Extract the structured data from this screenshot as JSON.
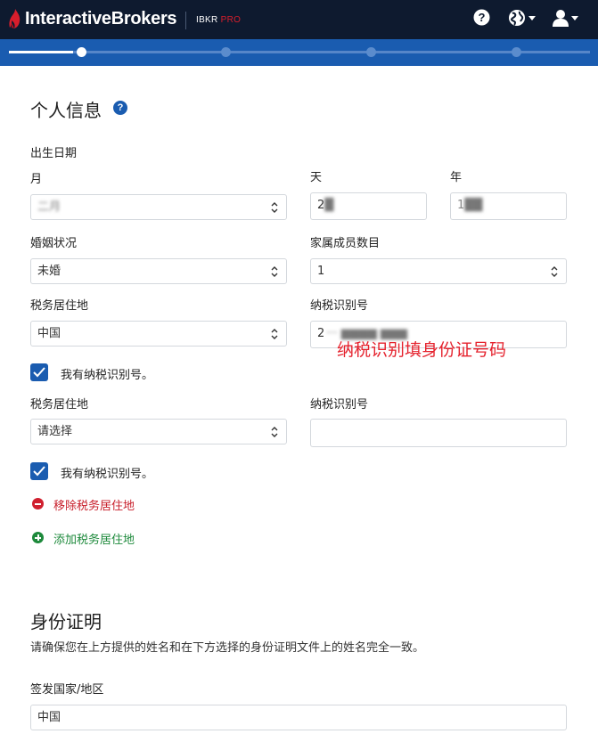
{
  "header": {
    "brand": "InteractiveBrokers",
    "product_prefix": "IBKR ",
    "product_suffix": "PRO",
    "brand_color": "#0e1a2f",
    "accent_color": "#d81e2c",
    "icons": [
      "help-icon",
      "globe-icon",
      "user-icon"
    ]
  },
  "progress": {
    "total_steps": 4,
    "current_step": 1,
    "bar_color": "#1a5cb0"
  },
  "personal_info": {
    "title": "个人信息",
    "dob_label": "出生日期",
    "month_label": "月",
    "month_value": "二月",
    "day_label": "天",
    "day_value": "2",
    "year_label": "年",
    "year_value": "1",
    "marital_label": "婚姻状况",
    "marital_value": "未婚",
    "dependents_label": "家属成员数目",
    "dependents_value": "1",
    "tax_residence_label": "税务居住地",
    "tax_residence_value": "中国",
    "tin_label": "纳税识别号",
    "tin_value": "2",
    "annotation": "纳税识别填身份证号码",
    "has_tin_label": "我有纳税识别号。",
    "tax_residence_label_2": "税务居住地",
    "tax_residence_placeholder_2": "请选择",
    "tin_label_2": "纳税识别号",
    "tin_value_2": "",
    "has_tin_label_2": "我有纳税识别号。",
    "remove_link": "移除税务居住地",
    "add_link": "添加税务居住地"
  },
  "identity": {
    "title": "身份证明",
    "description": "请确保您在上方提供的姓名和在下方选择的身份证明文件上的姓名完全一致。",
    "issuing_country_label": "签发国家/地区",
    "issuing_country_value": "中国"
  }
}
